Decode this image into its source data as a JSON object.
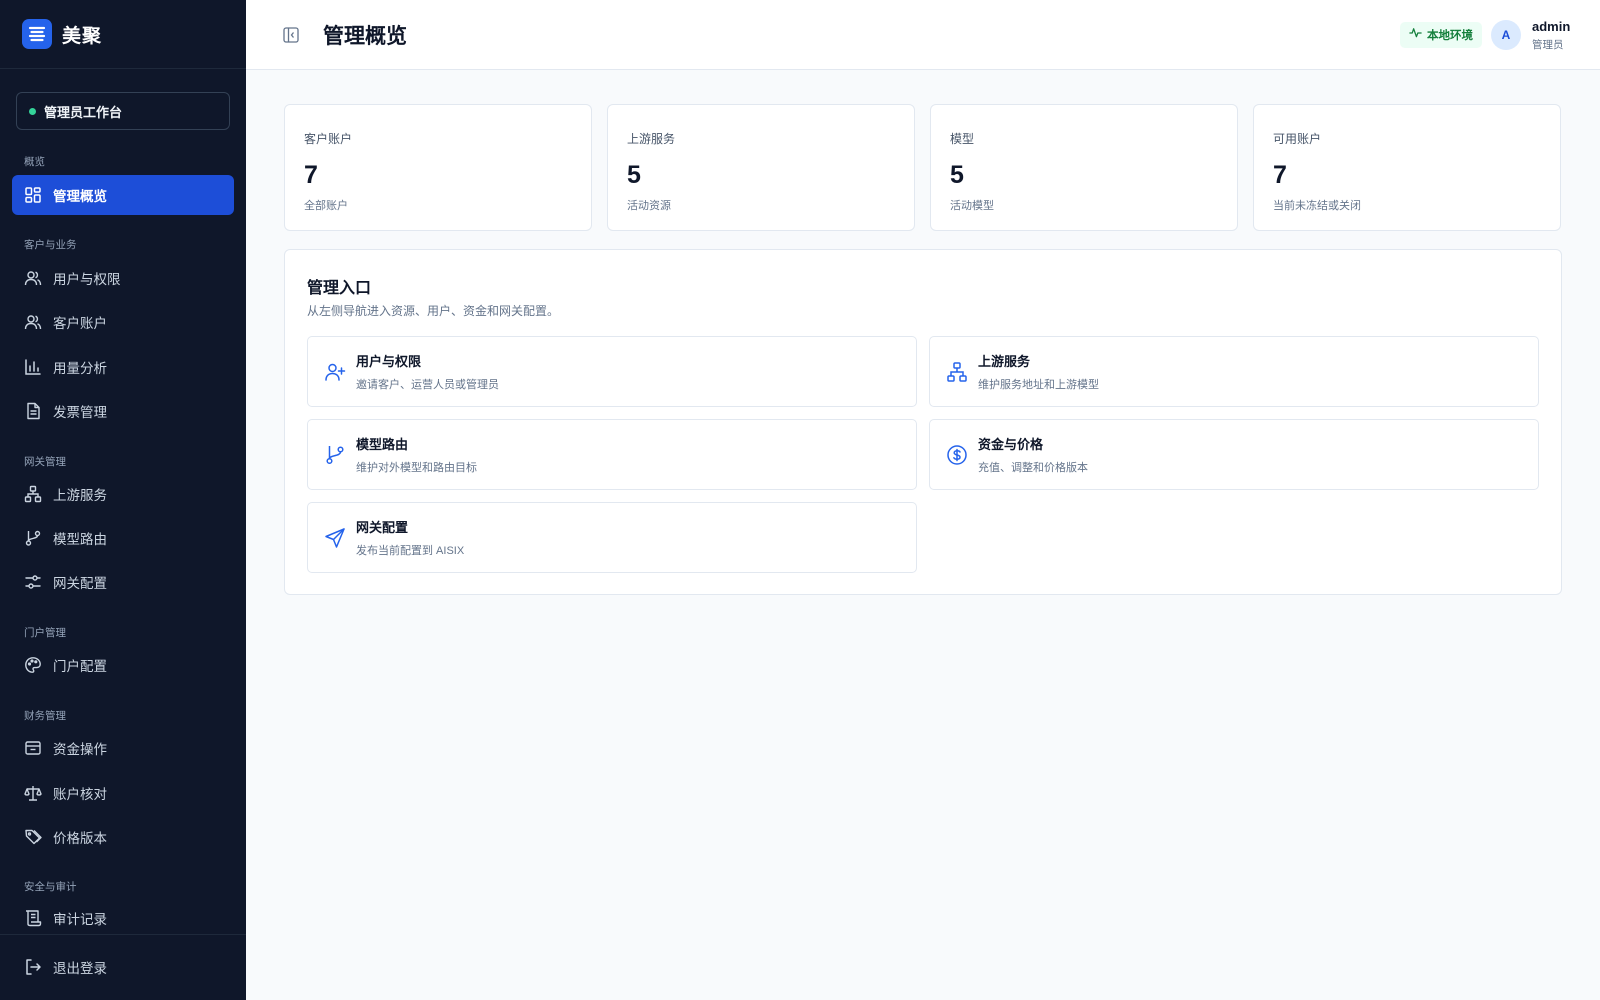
{
  "brand": {
    "name": "美聚"
  },
  "workspace": {
    "label": "管理员工作台"
  },
  "sidebar": {
    "sections": [
      "概览",
      "客户与业务",
      "网关管理",
      "门户管理",
      "财务管理",
      "安全与审计"
    ],
    "items": [
      {
        "label": "管理概览",
        "icon": "dashboard-icon",
        "active": true
      },
      {
        "label": "用户与权限",
        "icon": "users-icon"
      },
      {
        "label": "客户账户",
        "icon": "users-icon"
      },
      {
        "label": "用量分析",
        "icon": "bar-chart-icon"
      },
      {
        "label": "发票管理",
        "icon": "document-icon"
      },
      {
        "label": "上游服务",
        "icon": "network-icon"
      },
      {
        "label": "模型路由",
        "icon": "git-branch-icon"
      },
      {
        "label": "网关配置",
        "icon": "sliders-icon"
      },
      {
        "label": "门户配置",
        "icon": "palette-icon"
      },
      {
        "label": "资金操作",
        "icon": "wallet-icon"
      },
      {
        "label": "账户核对",
        "icon": "scale-icon"
      },
      {
        "label": "价格版本",
        "icon": "tags-icon"
      },
      {
        "label": "审计记录",
        "icon": "scroll-icon"
      }
    ],
    "logout_label": "退出登录"
  },
  "header": {
    "title": "管理概览",
    "env_label": "本地环境",
    "avatar_initial": "A",
    "user_name": "admin",
    "user_role": "管理员"
  },
  "stats": [
    {
      "label": "客户账户",
      "value": "7",
      "sub": "全部账户"
    },
    {
      "label": "上游服务",
      "value": "5",
      "sub": "活动资源"
    },
    {
      "label": "模型",
      "value": "5",
      "sub": "活动模型"
    },
    {
      "label": "可用账户",
      "value": "7",
      "sub": "当前未冻结或关闭"
    }
  ],
  "panel": {
    "title": "管理入口",
    "desc": "从左侧导航进入资源、用户、资金和网关配置。",
    "entries": [
      {
        "title": "用户与权限",
        "desc": "邀请客户、运营人员或管理员",
        "icon": "user-plus-icon"
      },
      {
        "title": "上游服务",
        "desc": "维护服务地址和上游模型",
        "icon": "network-icon"
      },
      {
        "title": "模型路由",
        "desc": "维护对外模型和路由目标",
        "icon": "git-branch-icon"
      },
      {
        "title": "资金与价格",
        "desc": "充值、调整和价格版本",
        "icon": "dollar-circle-icon"
      },
      {
        "title": "网关配置",
        "desc": "发布当前配置到 AISIX",
        "icon": "send-icon"
      }
    ]
  },
  "colors": {
    "sidebar_bg": "#0f172a",
    "accent": "#1d4ed8",
    "env_green": "#15803d"
  }
}
